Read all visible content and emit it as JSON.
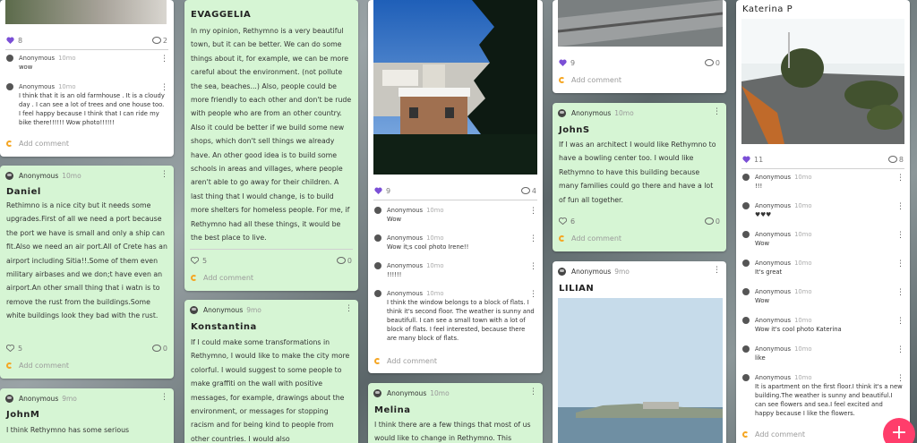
{
  "col1": {
    "top": {
      "likes": "8",
      "comments": "2",
      "c1_user": "Anonymous",
      "c1_time": "10mo",
      "c1_text": "wow",
      "c2_user": "Anonymous",
      "c2_time": "10mo",
      "c2_text": "I think that it is an old farmhouse . It is a cloudy day . I can see a lot of trees and one house too. I feel happy because I think that I can ride my bike there!!!!!! Wow photo!!!!!!",
      "add": "Add comment"
    },
    "daniel": {
      "user": "Anonymous",
      "time": "10mo",
      "title": "Daniel",
      "body": "Rethimno is a nice city but it needs some upgrades.First of all we need a port because the port we have is small and only a ship can fit.Also we need an air port.All of Crete has an airport including Sitia!!.Some of them even military airbases and we don;t have even an airport.An other small thing that i watn is to remove the rust from the buildings.Some white buildings look they bad with the rust.",
      "likes": "5",
      "comments": "0",
      "add": "Add comment"
    },
    "johnm": {
      "user": "Anonymous",
      "time": "9mo",
      "title": "JohnM",
      "body": "I think Rethymno has some serious"
    }
  },
  "col2": {
    "evaggelia": {
      "title": "EVAGGELIA",
      "body": "In my opinion, Rethymno is a very beautiful town, but it can be better. We can do some things about it, for example, we can be more careful about the environment. (not pollute the sea, beaches...) Also, people could be more friendly to each other and don't be rude with people who are from an other country. Also it could be better if we build some new shops, which don't sell things we already have. An other good idea is to build some schools in areas and villages, where people aren't able to go away for their children. A last thing that I would change, is to build more shelters for homeless people. For me, if Rethymno had all these things, it would be the best place to live.",
      "likes": "5",
      "comments": "0",
      "add": "Add comment"
    },
    "konstantina": {
      "user": "Anonymous",
      "time": "9mo",
      "title": "Konstantina",
      "body": "If I could make some transformations in Rethymno, I would like to make the city more colorful. I would suggest to some people to make graffiti on the wall with positive messages, for example, drawings about the environment, or messages for stopping racism and for being kind to people from other countries. I would also"
    }
  },
  "col3": {
    "photo": {
      "likes": "9",
      "comments": "4",
      "comments_list": [
        {
          "user": "Anonymous",
          "time": "10mo",
          "text": "Wow"
        },
        {
          "user": "Anonymous",
          "time": "10mo",
          "text": "Wow it;s cool photo Irene!!"
        },
        {
          "user": "Anonymous",
          "time": "10mo",
          "text": "!!!!!!"
        },
        {
          "user": "Anonymous",
          "time": "10mo",
          "text": "I think the window belongs to a block of flats. I think it's second floor. The weather is sunny and beautifull. I can see a small town with a lot of block of flats. I feel interested, because there are many block of flats."
        }
      ],
      "add": "Add comment"
    },
    "melina": {
      "user": "Anonymous",
      "time": "10mo",
      "title": "Melina",
      "body": "I think there are a few things that most of us would like to change in Rethymno. This"
    }
  },
  "col4": {
    "top": {
      "likes": "9",
      "comments": "0",
      "add": "Add comment"
    },
    "johns": {
      "user": "Anonymous",
      "time": "10mo",
      "title": "JohnS",
      "body": "If I was an architect I would like Rethymno to have a bowling center too. I would like Rethymno to have this building because many families could go there and have a lot of fun all together.",
      "likes": "6",
      "comments": "0",
      "add": "Add comment"
    },
    "lilian": {
      "user": "Anonymous",
      "time": "9mo",
      "title": "LILIAN"
    }
  },
  "col5": {
    "katerina": {
      "title": "Katerina P",
      "likes": "11",
      "comments": "8",
      "comments_list": [
        {
          "user": "Anonymous",
          "time": "10mo",
          "text": "!!!"
        },
        {
          "user": "Anonymous",
          "time": "10mo",
          "text": "♥♥♥"
        },
        {
          "user": "Anonymous",
          "time": "10mo",
          "text": "Wow"
        },
        {
          "user": "Anonymous",
          "time": "10mo",
          "text": "It's great"
        },
        {
          "user": "Anonymous",
          "time": "10mo",
          "text": "Wow"
        },
        {
          "user": "Anonymous",
          "time": "10mo",
          "text": "Wow it's cool photo Katerina"
        },
        {
          "user": "Anonymous",
          "time": "10mo",
          "text": "like"
        },
        {
          "user": "Anonymous",
          "time": "10mo",
          "text": "It is apartment on the first floor.I think it's a new building.The weather is sunny and beautiful.I can see flowers and sea.I feel excited and happy because I like the flowers."
        }
      ],
      "add": "Add comment"
    }
  },
  "fab": "+",
  "colors": {
    "card_green": "#d6f5d4",
    "like": "#7b4fd6",
    "fab": "#ff3d6b",
    "add_spinner": "#f5a623"
  }
}
